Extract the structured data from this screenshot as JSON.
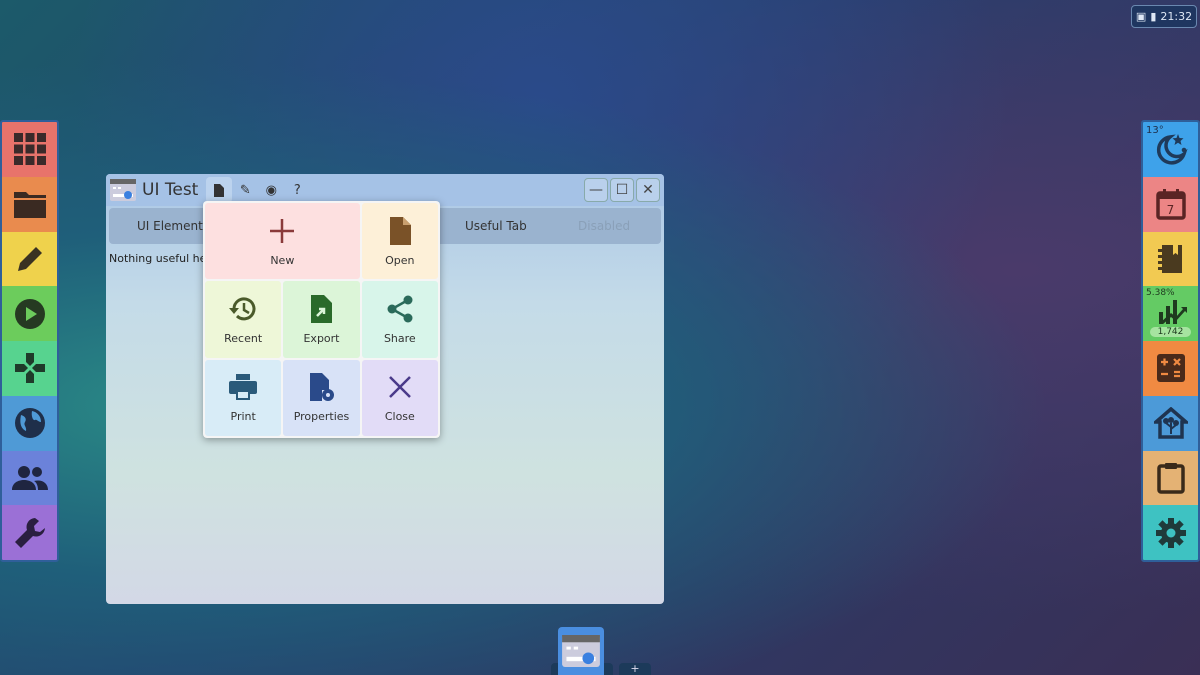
{
  "status": {
    "time": "21:32"
  },
  "left_dock": [
    {
      "name": "app-grid",
      "icon": "grid-icon",
      "color": "#e8736b"
    },
    {
      "name": "files",
      "icon": "folder-icon",
      "color": "#e98b4e"
    },
    {
      "name": "editor",
      "icon": "pencil-icon",
      "color": "#efd24c"
    },
    {
      "name": "media",
      "icon": "play-icon",
      "color": "#6ccc5c"
    },
    {
      "name": "games",
      "icon": "gamepad-icon",
      "color": "#57d38f"
    },
    {
      "name": "browser",
      "icon": "globe-icon",
      "color": "#4f9ad6"
    },
    {
      "name": "contacts",
      "icon": "people-icon",
      "color": "#6b82da"
    },
    {
      "name": "tools",
      "icon": "wrench-icon",
      "color": "#9b70d6"
    }
  ],
  "right_dock": [
    {
      "name": "weather",
      "icon": "moon-stars-icon",
      "color": "#3ea2ea",
      "label": "13°"
    },
    {
      "name": "calendar",
      "icon": "calendar-icon",
      "color": "#ec8585",
      "label": "7"
    },
    {
      "name": "notes",
      "icon": "notebook-icon",
      "color": "#f2ca52"
    },
    {
      "name": "stocks",
      "icon": "chart-up-icon",
      "color": "#64cb64",
      "label": "5.38%",
      "value": "1,742"
    },
    {
      "name": "calculator",
      "icon": "calculator-icon",
      "color": "#f08a42"
    },
    {
      "name": "home",
      "icon": "smart-home-icon",
      "color": "#4c9ad8"
    },
    {
      "name": "clipboard",
      "icon": "clipboard-icon",
      "color": "#e4b274"
    },
    {
      "name": "settings",
      "icon": "gear-icon",
      "color": "#3ec2c2"
    }
  ],
  "window": {
    "title": "UI Test",
    "toolbar": [
      "file-icon",
      "pencil-icon",
      "eye-icon",
      "?"
    ],
    "tabs": [
      {
        "label": "UI Element"
      },
      {
        "label": "Useful Tab"
      },
      {
        "label": "Disabled",
        "disabled": true
      }
    ],
    "content": "Nothing useful her"
  },
  "menu": {
    "items": [
      {
        "label": "New",
        "color": "#fde0e0",
        "icon_color": "#8a3a3a"
      },
      {
        "label": "Open",
        "color": "#fdf0d8",
        "icon_color": "#7a5228"
      },
      {
        "label": "Recent",
        "color": "#eef7d8",
        "icon_color": "#4a5a2a"
      },
      {
        "label": "Export",
        "color": "#dcf5d8",
        "icon_color": "#2a6a2a"
      },
      {
        "label": "Share",
        "color": "#d8f5ea",
        "icon_color": "#2a6a5a"
      },
      {
        "label": "Print",
        "color": "#d8ecf7",
        "icon_color": "#2a5a7a"
      },
      {
        "label": "Properties",
        "color": "#d8e2f7",
        "icon_color": "#2a4a8a"
      },
      {
        "label": "Close",
        "color": "#e2dcf7",
        "icon_color": "#4a3a8a"
      }
    ]
  },
  "taskbar": {
    "add": "+"
  }
}
